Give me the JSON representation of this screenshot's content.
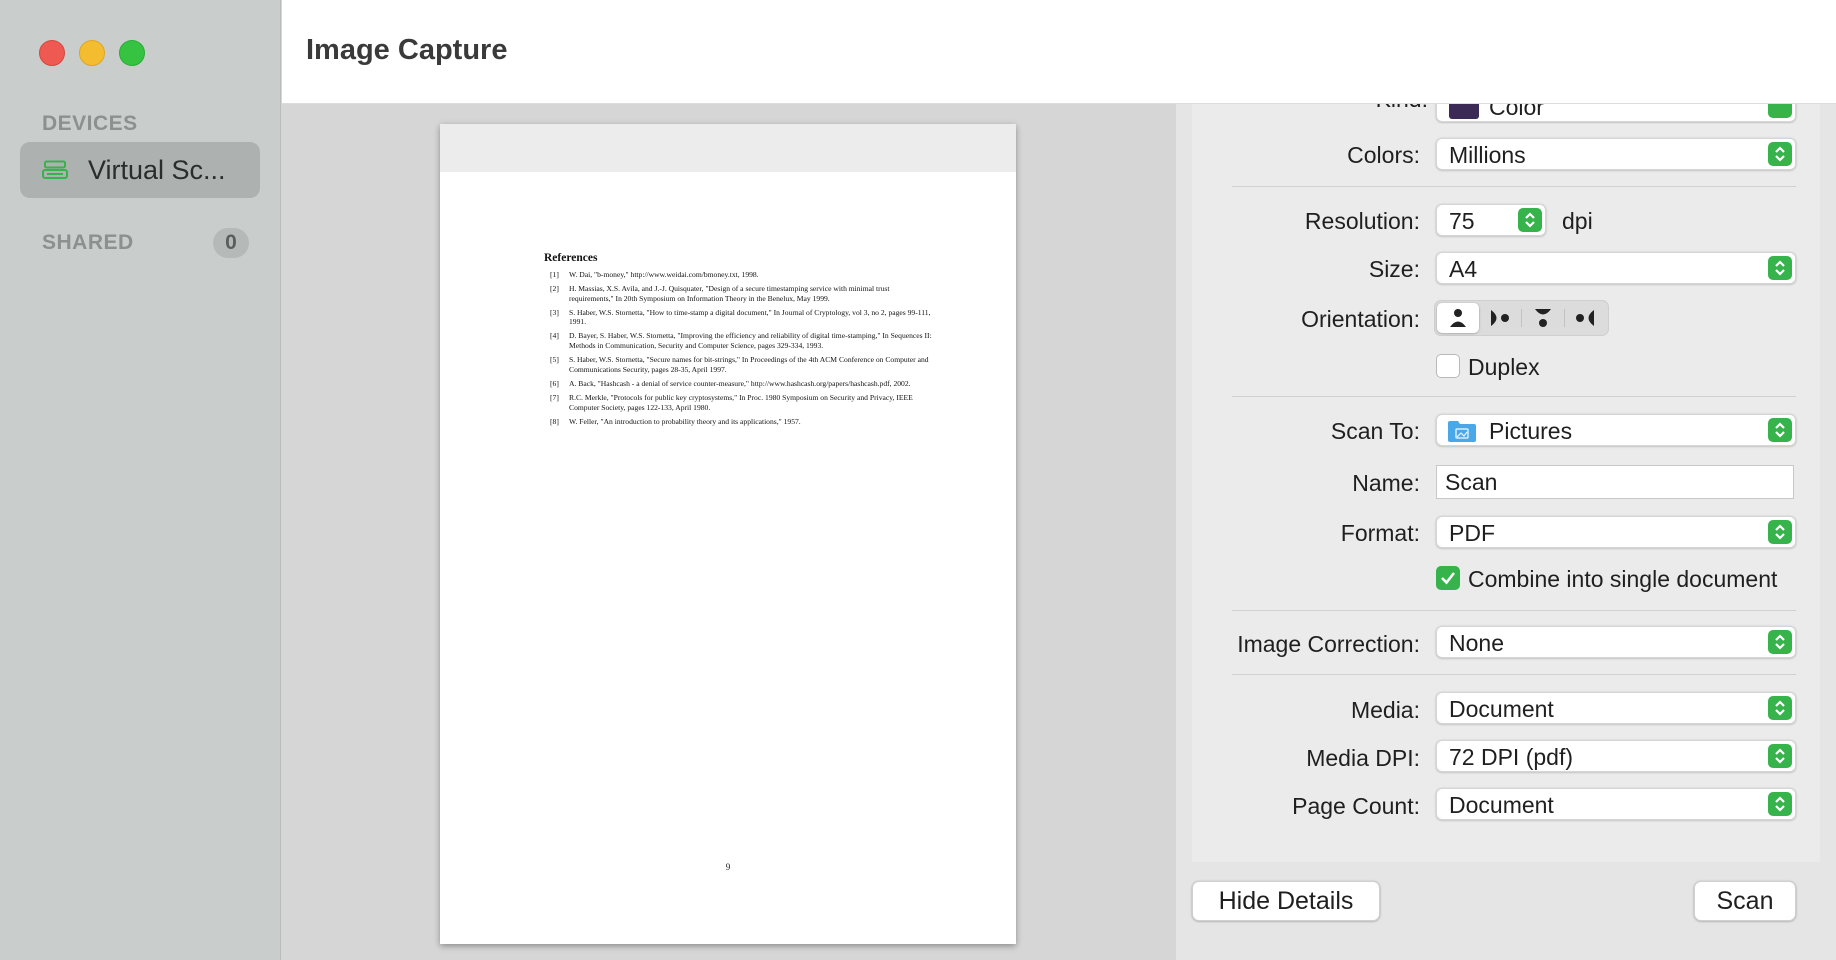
{
  "window": {
    "title": "Image Capture"
  },
  "sidebar": {
    "devices_title": "DEVICES",
    "devices": [
      {
        "label": "Virtual Sc...",
        "icon": "scanner-icon"
      }
    ],
    "shared_title": "SHARED",
    "shared_count": "0"
  },
  "preview": {
    "heading": "References",
    "references": [
      {
        "num": "[1]",
        "text": "W. Dai, \"b-money,\" http://www.weidai.com/bmoney.txt, 1998."
      },
      {
        "num": "[2]",
        "text": "H. Massias, X.S. Avila, and J.-J. Quisquater, \"Design of a secure timestamping service with minimal trust requirements,\" In 20th Symposium on Information Theory in the Benelux, May 1999."
      },
      {
        "num": "[3]",
        "text": "S. Haber, W.S. Stornetta, \"How to time-stamp a digital document,\" In Journal of Cryptology, vol 3, no 2, pages 99-111, 1991."
      },
      {
        "num": "[4]",
        "text": "D. Bayer, S. Haber, W.S. Stornetta, \"Improving the efficiency and reliability of digital time-stamping,\" In Sequences II: Methods in Communication, Security and Computer Science, pages 329-334, 1993."
      },
      {
        "num": "[5]",
        "text": "S. Haber, W.S. Stornetta, \"Secure names for bit-strings,\" In Proceedings of the 4th ACM Conference on Computer and Communications Security, pages 28-35, April 1997."
      },
      {
        "num": "[6]",
        "text": "A. Back, \"Hashcash - a denial of service counter-measure,\" http://www.hashcash.org/papers/hashcash.pdf, 2002."
      },
      {
        "num": "[7]",
        "text": "R.C. Merkle, \"Protocols for public key cryptosystems,\" In Proc. 1980 Symposium on Security and Privacy, IEEE Computer Society, pages 122-133, April 1980."
      },
      {
        "num": "[8]",
        "text": "W. Feller, \"An introduction to probability theory and its applications,\" 1957."
      }
    ],
    "page_number": "9"
  },
  "settings": {
    "kind": {
      "label": "Kind:",
      "value": "Color"
    },
    "colors": {
      "label": "Colors:",
      "value": "Millions"
    },
    "resolution": {
      "label": "Resolution:",
      "value": "75",
      "unit": "dpi"
    },
    "size": {
      "label": "Size:",
      "value": "A4"
    },
    "orientation": {
      "label": "Orientation:",
      "selected_index": 0
    },
    "duplex": {
      "label": "Duplex",
      "checked": false
    },
    "scan_to": {
      "label": "Scan To:",
      "value": "Pictures"
    },
    "name": {
      "label": "Name:",
      "value": "Scan"
    },
    "format": {
      "label": "Format:",
      "value": "PDF"
    },
    "combine": {
      "label": "Combine into single document",
      "checked": true
    },
    "image_correction": {
      "label": "Image Correction:",
      "value": "None"
    },
    "media": {
      "label": "Media:",
      "value": "Document"
    },
    "media_dpi": {
      "label": "Media DPI:",
      "value": "72 DPI (pdf)"
    },
    "page_count": {
      "label": "Page Count:",
      "value": "Document"
    }
  },
  "buttons": {
    "hide_details": "Hide Details",
    "scan": "Scan"
  },
  "colors": {
    "accent": "#36b34a",
    "sidebar_bg": "#c9cdcb",
    "panel_bg": "#ebebeb"
  }
}
